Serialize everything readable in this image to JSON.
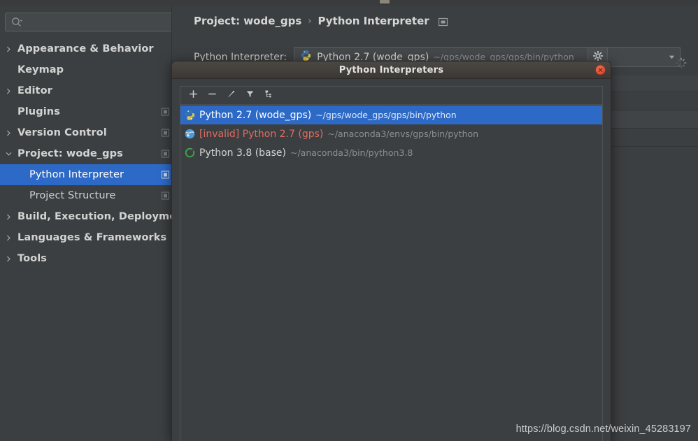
{
  "window": {
    "background_color": "#3c3f41"
  },
  "sidebar": {
    "search": {
      "value": "",
      "placeholder": "",
      "icon": "search-icon"
    },
    "items": [
      {
        "label": "Appearance & Behavior",
        "arrow": "chevron-right",
        "level": 0,
        "selected": false,
        "badge": false
      },
      {
        "label": "Keymap",
        "arrow": "none",
        "level": 0,
        "selected": false,
        "badge": false
      },
      {
        "label": "Editor",
        "arrow": "chevron-right",
        "level": 0,
        "selected": false,
        "badge": false
      },
      {
        "label": "Plugins",
        "arrow": "none",
        "level": 0,
        "selected": false,
        "badge": true
      },
      {
        "label": "Version Control",
        "arrow": "chevron-right",
        "level": 0,
        "selected": false,
        "badge": true
      },
      {
        "label": "Project: wode_gps",
        "arrow": "chevron-down",
        "level": 0,
        "selected": false,
        "badge": true
      },
      {
        "label": "Python Interpreter",
        "arrow": "none",
        "level": 1,
        "selected": true,
        "badge": true
      },
      {
        "label": "Project Structure",
        "arrow": "none",
        "level": 1,
        "selected": false,
        "badge": true
      },
      {
        "label": "Build, Execution, Deployment",
        "arrow": "chevron-right",
        "level": 0,
        "selected": false,
        "badge": false
      },
      {
        "label": "Languages & Frameworks",
        "arrow": "chevron-right",
        "level": 0,
        "selected": false,
        "badge": false
      },
      {
        "label": "Tools",
        "arrow": "chevron-right",
        "level": 0,
        "selected": false,
        "badge": false
      }
    ]
  },
  "main": {
    "breadcrumb": {
      "root": "Project: wode_gps",
      "separator": "›",
      "leaf": "Python Interpreter",
      "trailing_icon": "window-restore-icon"
    },
    "interpreter_field": {
      "label": "Python Interpreter:",
      "selected_name": "Python 2.7 (wode_gps)",
      "selected_path": "~/gps/wode_gps/gps/bin/python",
      "icon": "python-virtualenv-icon",
      "dropdown_icon": "chevron-down-icon"
    },
    "gear_button": {
      "icon": "gear-icon",
      "label": ""
    },
    "loading_indicator": "spinner-icon"
  },
  "dialog": {
    "title": "Python Interpreters",
    "close_button_icon": "close-icon",
    "toolbar": [
      {
        "name": "add-interpreter-button",
        "icon": "plus-icon"
      },
      {
        "name": "remove-interpreter-button",
        "icon": "minus-icon"
      },
      {
        "name": "edit-interpreter-button",
        "icon": "pencil-icon"
      },
      {
        "name": "filter-button",
        "icon": "funnel-icon"
      },
      {
        "name": "show-paths-button",
        "icon": "tree-paths-icon"
      }
    ],
    "interpreters": [
      {
        "name": "Python 2.7 (wode_gps)",
        "path": "~/gps/wode_gps/gps/bin/python",
        "icon": "python-virtualenv-icon",
        "selected": true,
        "invalid": false
      },
      {
        "name": "[invalid] Python 2.7 (gps)",
        "path": "~/anaconda3/envs/gps/bin/python",
        "icon": "conda-env-icon",
        "selected": false,
        "invalid": true
      },
      {
        "name": "Python 3.8 (base)",
        "path": "~/anaconda3/bin/python3.8",
        "icon": "conda-base-icon",
        "selected": false,
        "invalid": false
      }
    ]
  },
  "watermark": {
    "text": "https://blog.csdn.net/weixin_45283197"
  },
  "colors": {
    "accent_selection": "#2d6ac7",
    "invalid_text": "#e06c62",
    "panel_background": "#3c3f41",
    "close_button": "#e2543a"
  }
}
